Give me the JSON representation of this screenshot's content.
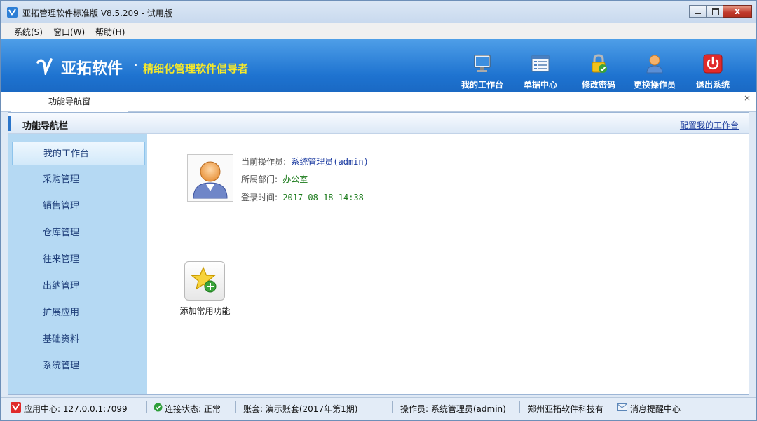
{
  "window": {
    "title": "亚拓管理软件标准版 V8.5.209 - 试用版",
    "close_glyph": "x"
  },
  "menu": [
    {
      "label": "系统(S)"
    },
    {
      "label": "窗口(W)"
    },
    {
      "label": "帮助(H)"
    }
  ],
  "banner": {
    "brand_name": "亚拓软件",
    "dot": "·",
    "slogan": "精细化管理软件倡导者",
    "tools": [
      {
        "label": "我的工作台",
        "icon": "monitor-icon"
      },
      {
        "label": "单据中心",
        "icon": "document-list-icon"
      },
      {
        "label": "修改密码",
        "icon": "lock-icon"
      },
      {
        "label": "更换操作员",
        "icon": "user-icon"
      },
      {
        "label": "退出系统",
        "icon": "power-icon"
      }
    ]
  },
  "tabs": [
    {
      "label": "功能导航窗",
      "active": true
    }
  ],
  "tab_close": "×",
  "panel": {
    "title": "功能导航栏",
    "config_link": "配置我的工作台"
  },
  "sidebar": {
    "items": [
      {
        "label": "我的工作台",
        "active": true
      },
      {
        "label": "采购管理"
      },
      {
        "label": "销售管理"
      },
      {
        "label": "仓库管理"
      },
      {
        "label": "往来管理"
      },
      {
        "label": "出纳管理"
      },
      {
        "label": "扩展应用"
      },
      {
        "label": "基础资料"
      },
      {
        "label": "系统管理"
      }
    ]
  },
  "user_info": {
    "operator_label": "当前操作员:",
    "operator_value": "系统管理员(admin)",
    "dept_label": "所属部门:",
    "dept_value": "办公室",
    "login_label": "登录时间:",
    "login_value": "2017-08-18 14:38"
  },
  "favorites": {
    "add_label": "添加常用功能",
    "icon": "star-add-icon"
  },
  "statusbar": {
    "app_center": "应用中心: 127.0.0.1:7099",
    "connection": "连接状态: 正常",
    "account": "账套: 演示账套(2017年第1期)",
    "operator": "操作员: 系统管理员(admin)",
    "company": "郑州亚拓软件科技有",
    "message_center": "消息提醒中心"
  },
  "colors": {
    "banner": "#1e73d0",
    "slogan": "#f5e82a",
    "sidebar": "#b5d9f3",
    "accent_bar": "#2a74c9"
  }
}
